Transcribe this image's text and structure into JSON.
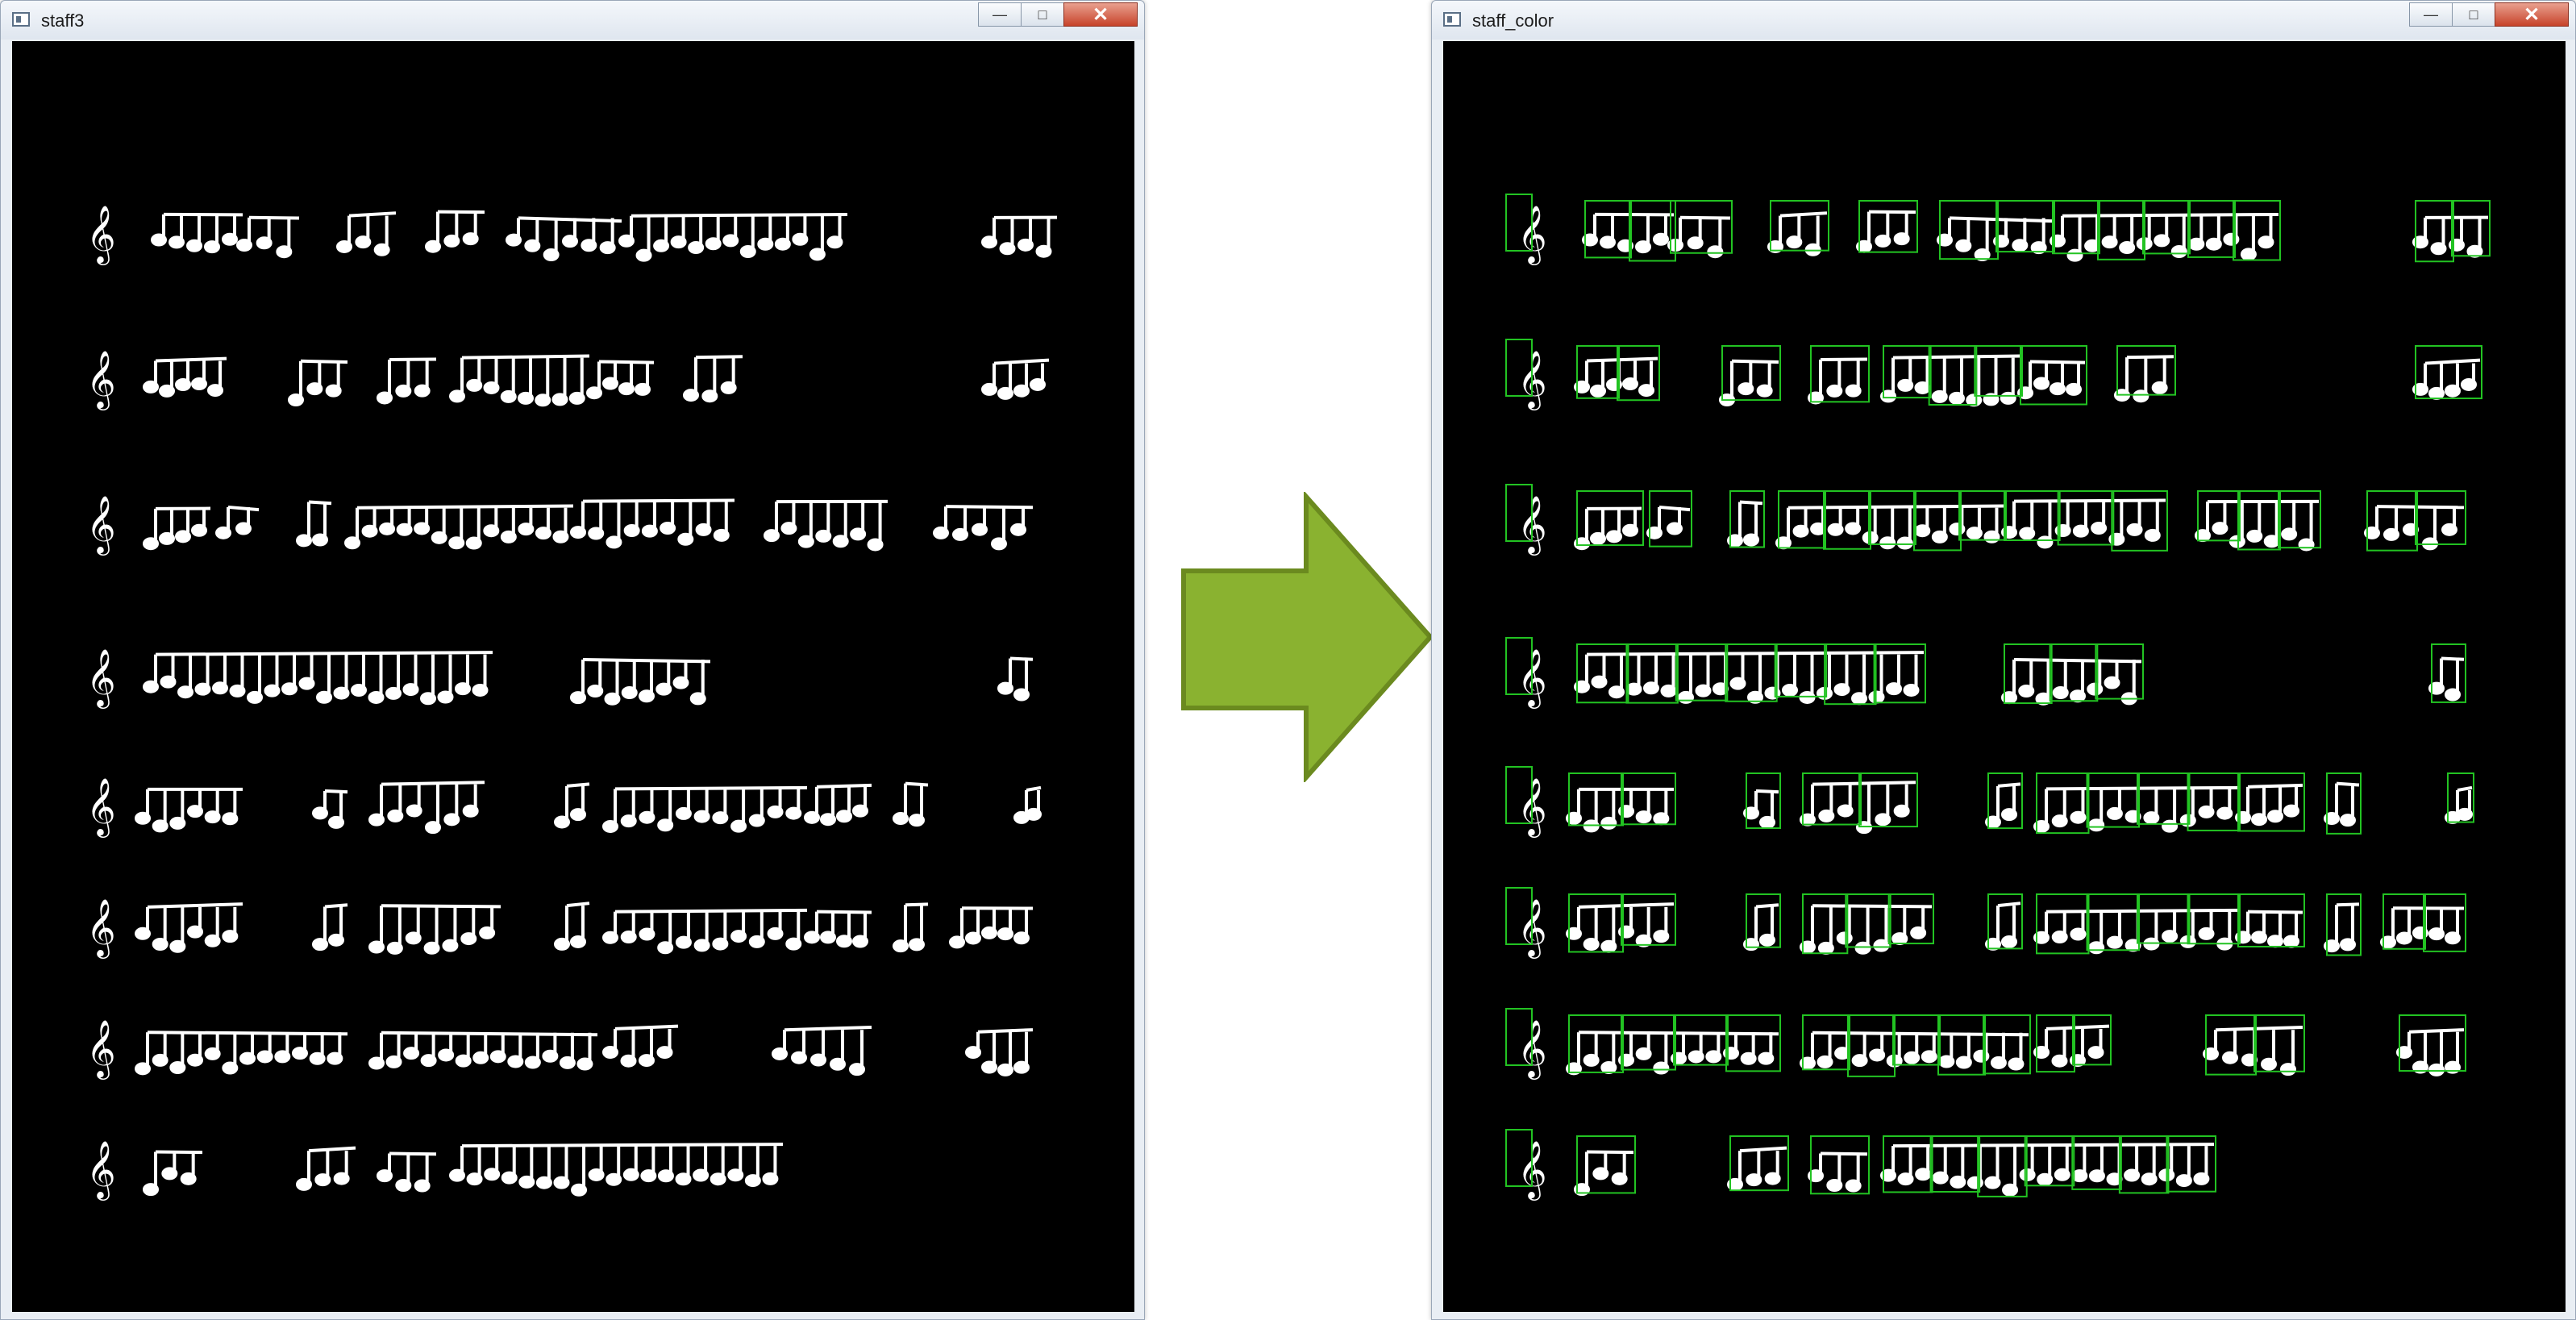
{
  "window_left": {
    "title": "staff3",
    "icon": "window-app-icon"
  },
  "window_right": {
    "title": "staff_color",
    "icon": "window-app-icon"
  },
  "controls": {
    "minimize_icon": "minimize-icon",
    "maximize_icon": "maximize-icon",
    "close_icon": "close-icon"
  },
  "arrow": {
    "color": "#8ab230",
    "border": "#6b8a1f"
  },
  "staff": {
    "notes_color": "#ffffff",
    "box_color": "#22c322",
    "background": "#000000"
  }
}
